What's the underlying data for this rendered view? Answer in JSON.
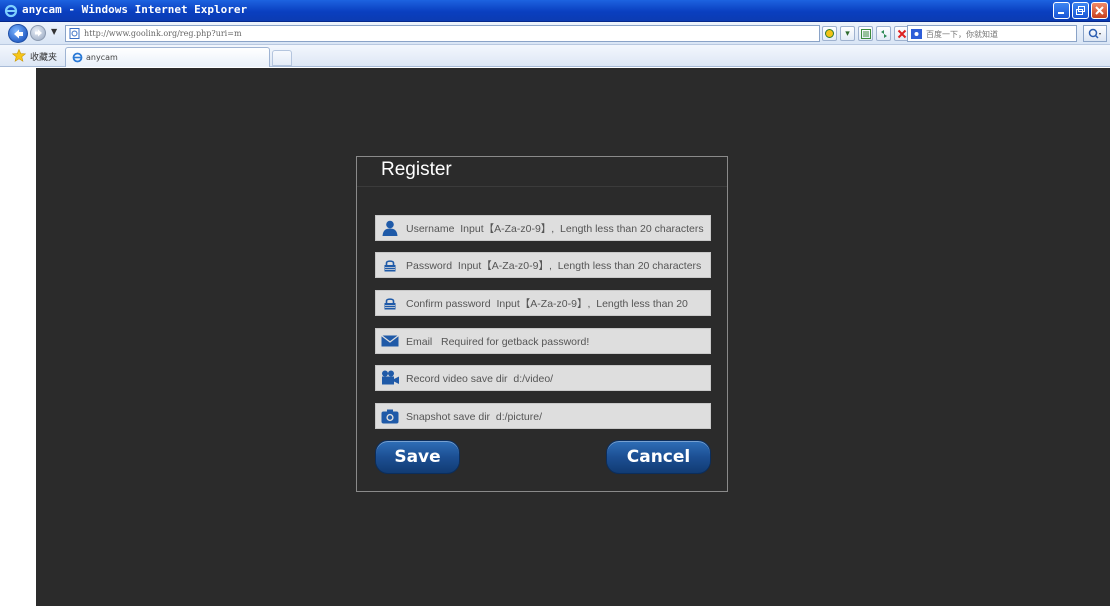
{
  "window": {
    "title": "anycam - Windows Internet Explorer"
  },
  "address_bar": {
    "url": "http://www.goolink.org/reg.php?uri=m",
    "search_placeholder": "百度一下，你就知道"
  },
  "favorites_bar": {
    "favorites_label": "收藏夹",
    "tab_label": "anycam"
  },
  "dialog": {
    "title": "Register",
    "fields": [
      {
        "name": "username",
        "placeholder": "Username  Input【A-Za-z0-9】,  Length less than 20 characters",
        "icon": "user-icon"
      },
      {
        "name": "password",
        "placeholder": "Password  Input【A-Za-z0-9】,  Length less than 20 characters",
        "icon": "lock-icon"
      },
      {
        "name": "confirm_password",
        "placeholder": "Confirm password  Input【A-Za-z0-9】,  Length less than 20",
        "icon": "lock-icon"
      },
      {
        "name": "email",
        "placeholder": "Email   Required for getback password!",
        "icon": "envelope-icon"
      },
      {
        "name": "record_dir",
        "placeholder": "Record video save dir  d:/video/",
        "icon": "video-camera-icon"
      },
      {
        "name": "snapshot_dir",
        "placeholder": "Snapshot save dir  d:/picture/",
        "icon": "camera-icon"
      }
    ],
    "save_label": "Save",
    "cancel_label": "Cancel"
  },
  "colors": {
    "page_background": "#2b2b2b",
    "button_blue": "#1c4f93",
    "titlebar_blue": "#0a3fc0"
  }
}
